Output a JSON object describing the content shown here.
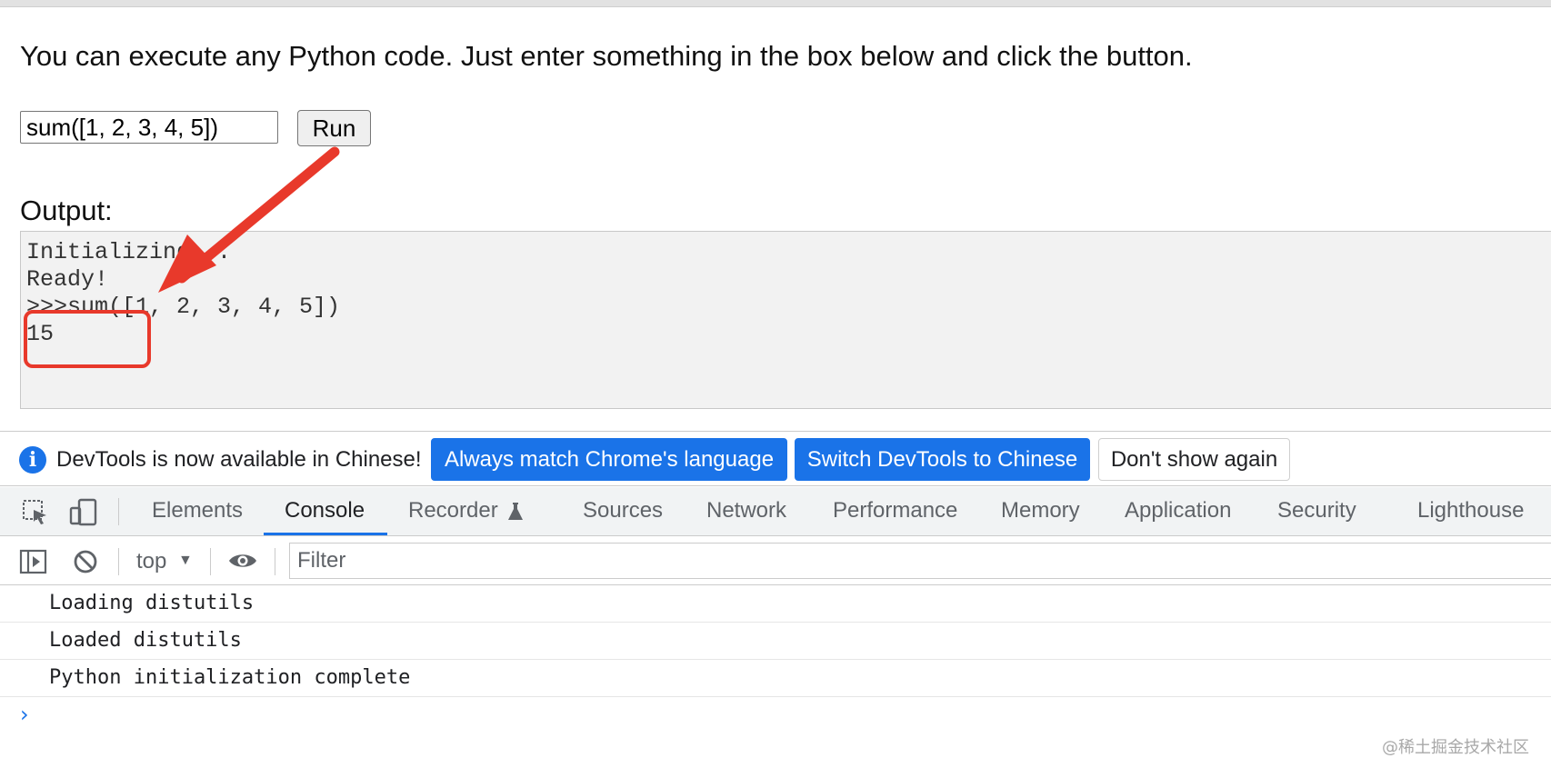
{
  "page": {
    "intro_text": "You can execute any Python code. Just enter something in the box below and click the button.",
    "input_value": "sum([1, 2, 3, 4, 5])",
    "run_label": "Run",
    "output_label": "Output:",
    "output_lines": [
      "Initializing...",
      "Ready!",
      ">>>sum([1, 2, 3, 4, 5])",
      "15"
    ]
  },
  "infobar": {
    "message": "DevTools is now available in Chinese!",
    "btn_match": "Always match Chrome's language",
    "btn_switch": "Switch DevTools to Chinese",
    "btn_dismiss": "Don't show again"
  },
  "tabs": [
    "Elements",
    "Console",
    "Recorder",
    "Sources",
    "Network",
    "Performance",
    "Memory",
    "Application",
    "Security",
    "Lighthouse"
  ],
  "console_toolbar": {
    "context": "top",
    "filter_placeholder": "Filter"
  },
  "console_messages": [
    "Loading distutils",
    "Loaded distutils",
    "Python initialization complete"
  ],
  "watermark": "@稀土掘金技术社区",
  "colors": {
    "accent": "#1a73e8",
    "annotation": "#e8392b"
  }
}
